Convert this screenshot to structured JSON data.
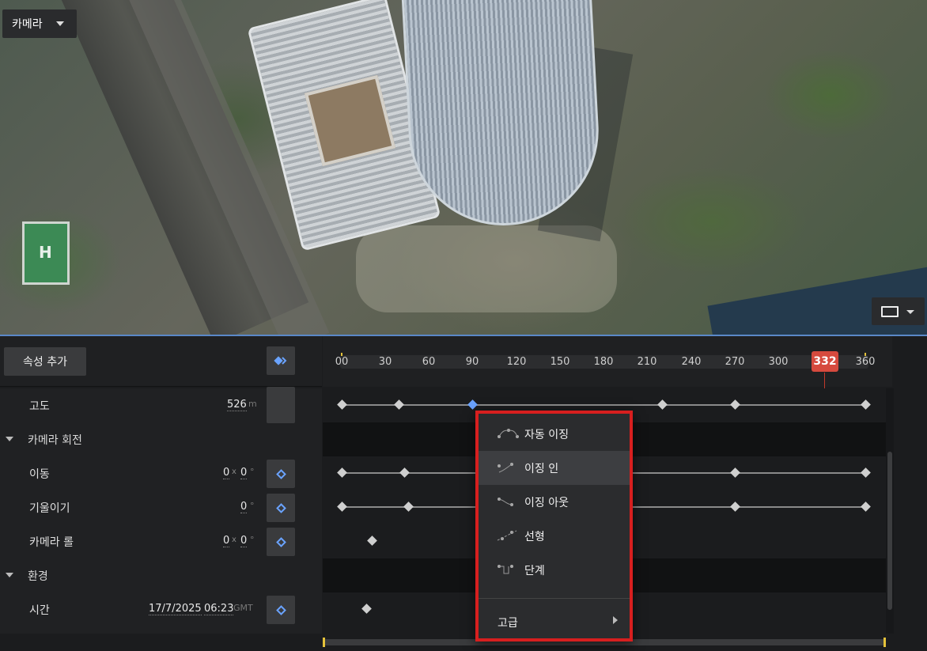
{
  "viewport": {
    "camera_dropdown": "카메라",
    "icons": {
      "camera_caret": "chevron-down-icon",
      "aspect": "aspect-ratio-icon"
    }
  },
  "left_panel": {
    "add_attribute_label": "속성 추가",
    "rows": {
      "altitude": {
        "label": "고도",
        "value": "526",
        "unit": "m"
      },
      "camera_rotation": {
        "label": "카메라 회전"
      },
      "pan": {
        "label": "이동",
        "x": "0",
        "sep": "x",
        "y": "0",
        "unit": "°"
      },
      "tilt": {
        "label": "기울이기",
        "value": "0",
        "unit": "°"
      },
      "roll": {
        "label": "카메라 롤",
        "x": "0",
        "sep": "x",
        "y": "0",
        "unit": "°"
      },
      "environment": {
        "label": "환경"
      },
      "time": {
        "label": "시간",
        "date": "17/7/2025",
        "clock": "06:23",
        "tz": "GMT"
      }
    }
  },
  "timeline": {
    "ticks": [
      "00",
      "30",
      "60",
      "90",
      "120",
      "150",
      "180",
      "210",
      "240",
      "270",
      "300",
      "360"
    ],
    "playhead": "332",
    "accent": "#d64a3e",
    "keyframe_color": "#cfcfcf",
    "selected_keyframe_color": "#6aa3ff"
  },
  "context_menu": {
    "items": [
      {
        "label": "자동 이징",
        "icon": "easing-auto-icon"
      },
      {
        "label": "이징 인",
        "icon": "easing-in-icon",
        "active": true
      },
      {
        "label": "이징 아웃",
        "icon": "easing-out-icon"
      },
      {
        "label": "선형",
        "icon": "linear-icon"
      },
      {
        "label": "단계",
        "icon": "step-icon"
      }
    ],
    "advanced": "고급",
    "highlight_color": "#d71f1f"
  }
}
